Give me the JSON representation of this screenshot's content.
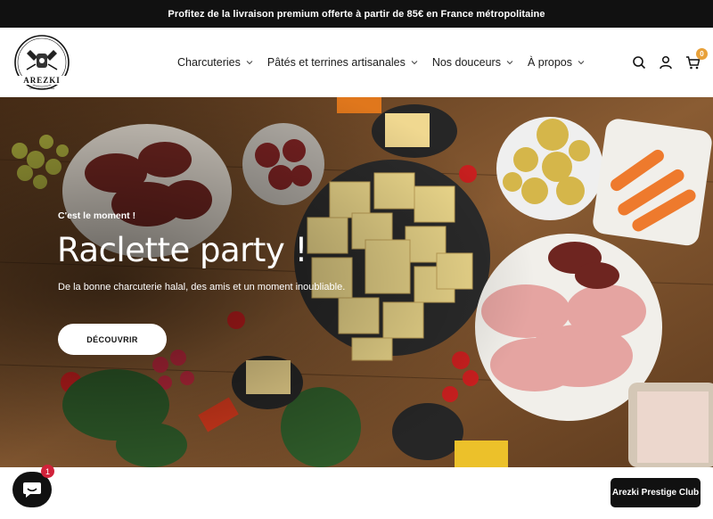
{
  "announcement": "Profitez de la livraison premium offerte à partir de 85€ en France métropolitaine",
  "brand": {
    "logo_text": "AREZKI",
    "logo_sub": "Artisan charcutier · halal"
  },
  "nav": [
    {
      "label": "Charcuteries",
      "icon": "chevron-down-icon"
    },
    {
      "label": "Pâtés et terrines artisanales",
      "icon": "chevron-down-icon"
    },
    {
      "label": "Nos douceurs",
      "icon": "chevron-down-icon"
    },
    {
      "label": "À propos",
      "icon": "chevron-down-icon"
    }
  ],
  "header_icons": {
    "search": "search-icon",
    "account": "user-icon",
    "cart": "cart-icon",
    "cart_count": "0"
  },
  "hero": {
    "kicker": "C'est le moment !",
    "title": "Raclette party !",
    "subtitle": "De la bonne charcuterie halal, des amis et un moment inoubliable.",
    "button": "DÉCOUVRIR"
  },
  "chat": {
    "icon": "chat-icon",
    "badge": "1"
  },
  "prestige_button": "Arezki Prestige Club",
  "colors": {
    "announce_bg": "#111111",
    "cart_badge": "#e8a13a",
    "chat_badge": "#d1223a",
    "wood": "#7a5230"
  }
}
